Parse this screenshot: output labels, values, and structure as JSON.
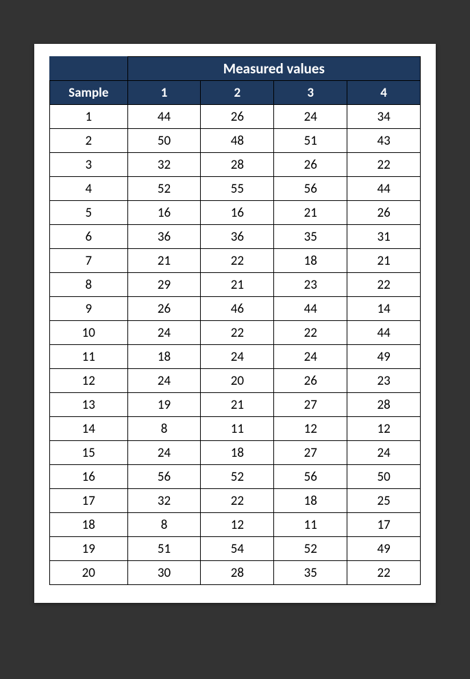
{
  "table": {
    "spanner_label": "Measured values",
    "sample_label": "Sample",
    "column_headers": [
      "1",
      "2",
      "3",
      "4"
    ],
    "rows": [
      {
        "sample": "1",
        "v": [
          "44",
          "26",
          "24",
          "34"
        ]
      },
      {
        "sample": "2",
        "v": [
          "50",
          "48",
          "51",
          "43"
        ]
      },
      {
        "sample": "3",
        "v": [
          "32",
          "28",
          "26",
          "22"
        ]
      },
      {
        "sample": "4",
        "v": [
          "52",
          "55",
          "56",
          "44"
        ]
      },
      {
        "sample": "5",
        "v": [
          "16",
          "16",
          "21",
          "26"
        ]
      },
      {
        "sample": "6",
        "v": [
          "36",
          "36",
          "35",
          "31"
        ]
      },
      {
        "sample": "7",
        "v": [
          "21",
          "22",
          "18",
          "21"
        ]
      },
      {
        "sample": "8",
        "v": [
          "29",
          "21",
          "23",
          "22"
        ]
      },
      {
        "sample": "9",
        "v": [
          "26",
          "46",
          "44",
          "14"
        ]
      },
      {
        "sample": "10",
        "v": [
          "24",
          "22",
          "22",
          "44"
        ]
      },
      {
        "sample": "11",
        "v": [
          "18",
          "24",
          "24",
          "49"
        ]
      },
      {
        "sample": "12",
        "v": [
          "24",
          "20",
          "26",
          "23"
        ]
      },
      {
        "sample": "13",
        "v": [
          "19",
          "21",
          "27",
          "28"
        ]
      },
      {
        "sample": "14",
        "v": [
          "8",
          "11",
          "12",
          "12"
        ]
      },
      {
        "sample": "15",
        "v": [
          "24",
          "18",
          "27",
          "24"
        ]
      },
      {
        "sample": "16",
        "v": [
          "56",
          "52",
          "56",
          "50"
        ]
      },
      {
        "sample": "17",
        "v": [
          "32",
          "22",
          "18",
          "25"
        ]
      },
      {
        "sample": "18",
        "v": [
          "8",
          "12",
          "11",
          "17"
        ]
      },
      {
        "sample": "19",
        "v": [
          "51",
          "54",
          "52",
          "49"
        ]
      },
      {
        "sample": "20",
        "v": [
          "30",
          "28",
          "35",
          "22"
        ]
      }
    ]
  },
  "chart_data": {
    "type": "table",
    "title": "Measured values",
    "columns": [
      "Sample",
      "1",
      "2",
      "3",
      "4"
    ],
    "data": [
      [
        1,
        44,
        26,
        24,
        34
      ],
      [
        2,
        50,
        48,
        51,
        43
      ],
      [
        3,
        32,
        28,
        26,
        22
      ],
      [
        4,
        52,
        55,
        56,
        44
      ],
      [
        5,
        16,
        16,
        21,
        26
      ],
      [
        6,
        36,
        36,
        35,
        31
      ],
      [
        7,
        21,
        22,
        18,
        21
      ],
      [
        8,
        29,
        21,
        23,
        22
      ],
      [
        9,
        26,
        46,
        44,
        14
      ],
      [
        10,
        24,
        22,
        22,
        44
      ],
      [
        11,
        18,
        24,
        24,
        49
      ],
      [
        12,
        24,
        20,
        26,
        23
      ],
      [
        13,
        19,
        21,
        27,
        28
      ],
      [
        14,
        8,
        11,
        12,
        12
      ],
      [
        15,
        24,
        18,
        27,
        24
      ],
      [
        16,
        56,
        52,
        56,
        50
      ],
      [
        17,
        32,
        22,
        18,
        25
      ],
      [
        18,
        8,
        12,
        11,
        17
      ],
      [
        19,
        51,
        54,
        52,
        49
      ],
      [
        20,
        30,
        28,
        35,
        22
      ]
    ]
  }
}
